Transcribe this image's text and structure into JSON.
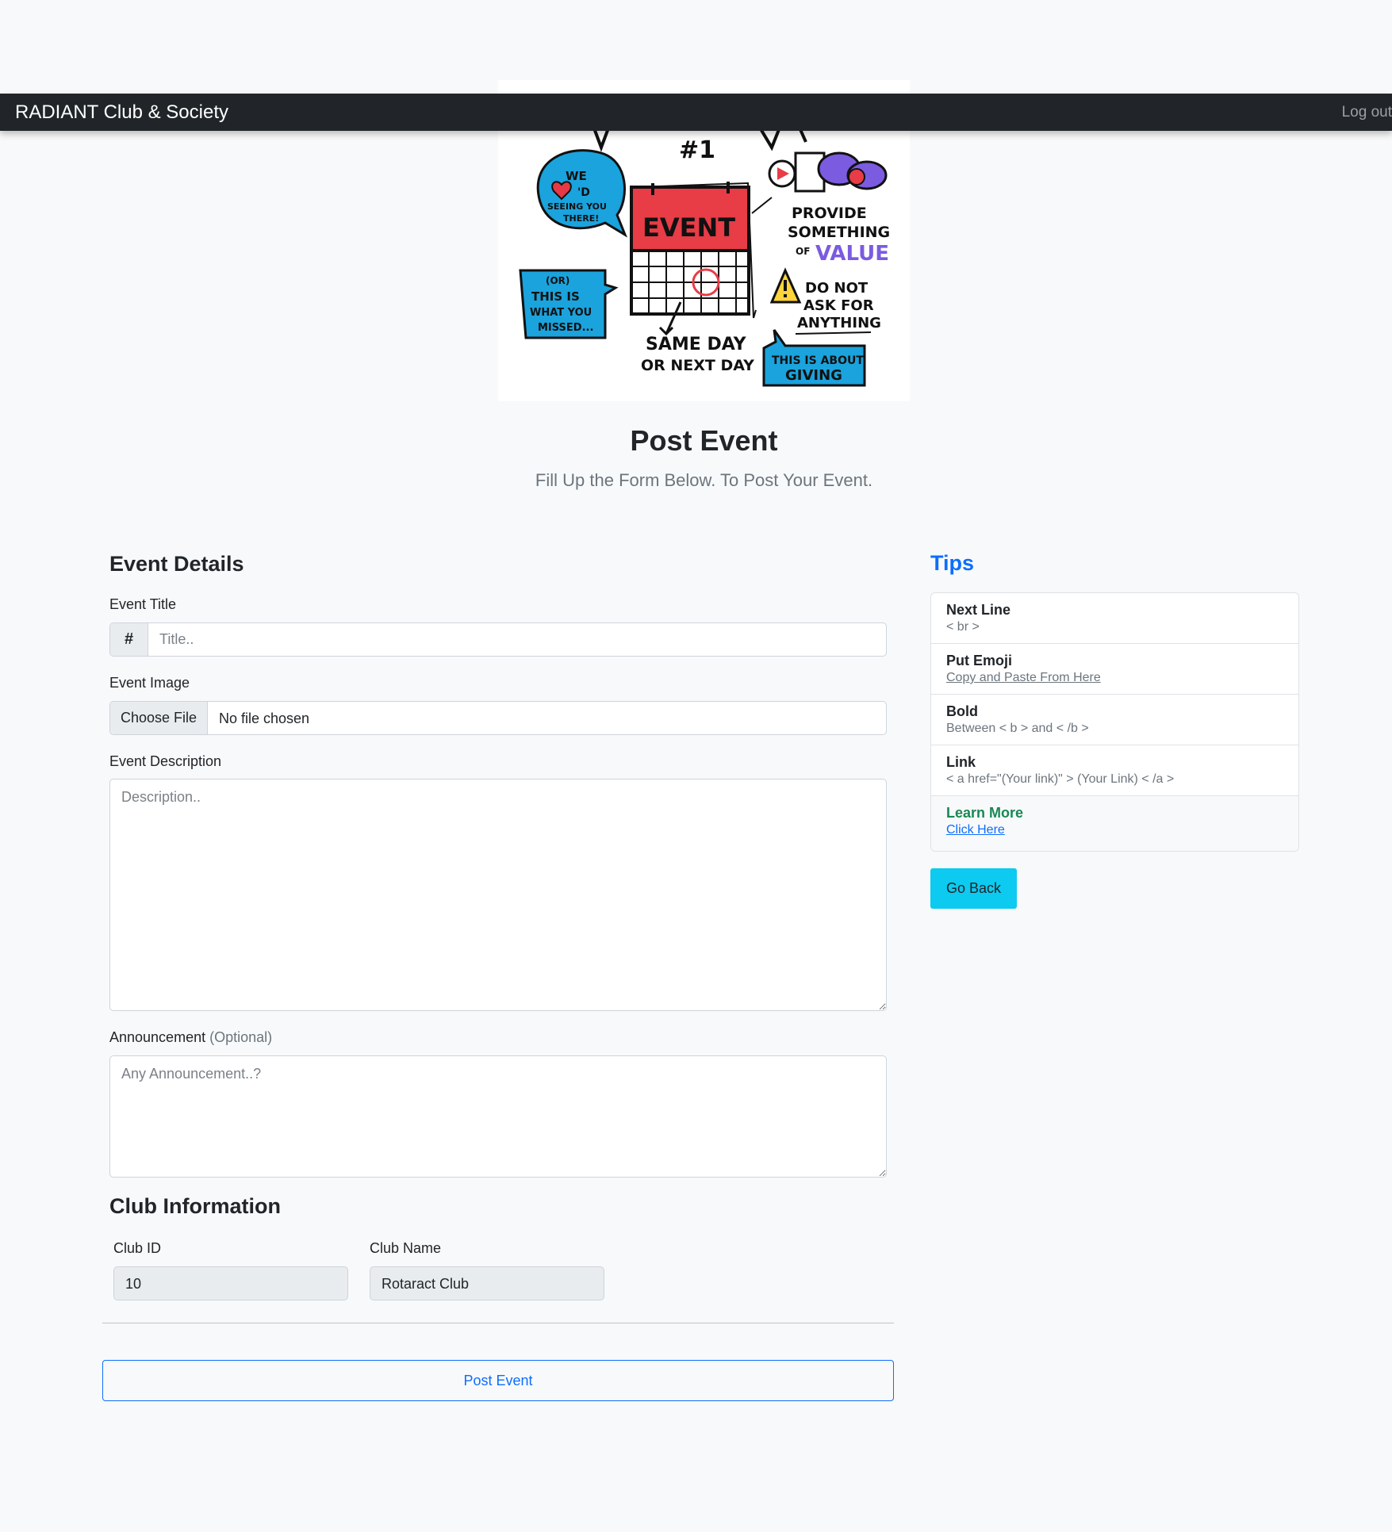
{
  "navbar": {
    "brand": "RADIANT Club & Society",
    "logout": "Log out"
  },
  "hero": {
    "number": "#1",
    "bubble_left": [
      "WE",
      "'D",
      "SEEING YOU",
      "THERE!"
    ],
    "box_left": [
      "(OR)",
      "THIS IS",
      "WHAT YOU",
      "MISSED..."
    ],
    "calendar": "EVENT",
    "same_day": [
      "SAME DAY",
      "OR NEXT DAY"
    ],
    "provide": [
      "PROVIDE",
      "SOMETHING",
      "OF",
      "VALUE"
    ],
    "do_not": [
      "DO NOT",
      "ASK FOR",
      "ANYTHING"
    ],
    "giving": [
      "THIS IS ABOUT",
      "GIVING"
    ]
  },
  "header": {
    "title": "Post Event",
    "subtitle": "Fill Up the Form Below. To Post Your Event."
  },
  "form": {
    "event_details_heading": "Event Details",
    "title_label": "Event Title",
    "title_addon": "#",
    "title_placeholder": "Title..",
    "image_label": "Event Image",
    "choose_file": "Choose File",
    "no_file": "No file chosen",
    "description_label": "Event Description",
    "description_placeholder": "Description..",
    "announcement_label": "Announcement",
    "announcement_optional": "(Optional)",
    "announcement_placeholder": "Any Announcement..?",
    "club_heading": "Club Information",
    "club_id_label": "Club ID",
    "club_id_value": "10",
    "club_name_label": "Club Name",
    "club_name_value": "Rotaract Club",
    "submit": "Post Event"
  },
  "tips": {
    "title": "Tips",
    "items": [
      {
        "title": "Next Line",
        "sub": "< br >"
      },
      {
        "title": "Put Emoji",
        "sub": "Copy and Paste From Here"
      },
      {
        "title": "Bold",
        "sub": "Between < b > and < /b >"
      },
      {
        "title": "Link",
        "sub": "< a href=\"(Your link)\" > (Your Link) < /a >"
      },
      {
        "title": "Learn More",
        "sub": "Click Here"
      }
    ],
    "go_back": "Go Back"
  },
  "colors": {
    "navbar": "#212529",
    "primary": "#0d6efd",
    "success": "#198754",
    "info": "#0dcaf0"
  }
}
